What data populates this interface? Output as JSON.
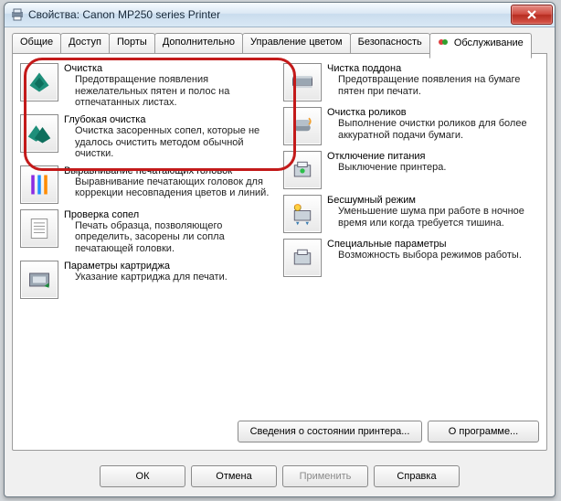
{
  "window": {
    "title": "Свойства: Canon MP250 series Printer"
  },
  "tabs": [
    {
      "label": "Общие"
    },
    {
      "label": "Доступ"
    },
    {
      "label": "Порты"
    },
    {
      "label": "Дополнительно"
    },
    {
      "label": "Управление цветом"
    },
    {
      "label": "Безопасность"
    },
    {
      "label": "Обслуживание"
    }
  ],
  "left": [
    {
      "title": "Очистка",
      "desc": "Предотвращение появления нежелательных пятен и полос на отпечатанных листах."
    },
    {
      "title": "Глубокая очистка",
      "desc": "Очистка засоренных сопел, которые не удалось очистить методом обычной очистки."
    },
    {
      "title": "Выравнивание печатающих головок",
      "desc": "Выравнивание печатающих головок для коррекции несовпадения цветов и линий."
    },
    {
      "title": "Проверка сопел",
      "desc": "Печать образца, позволяющего определить, засорены ли сопла печатающей головки."
    },
    {
      "title": "Параметры картриджа",
      "desc": "Указание картриджа для печати."
    }
  ],
  "right": [
    {
      "title": "Чистка поддона",
      "desc": "Предотвращение появления на бумаге пятен при печати."
    },
    {
      "title": "Очистка роликов",
      "desc": "Выполнение очистки роликов для более аккуратной подачи бумаги."
    },
    {
      "title": "Отключение питания",
      "desc": "Выключение принтера."
    },
    {
      "title": "Бесшумный режим",
      "desc": "Уменьшение шума при работе в ночное время или когда требуется тишина."
    },
    {
      "title": "Специальные параметры",
      "desc": "Возможность выбора режимов работы."
    }
  ],
  "panel_buttons": {
    "status": "Сведения о состоянии принтера...",
    "about": "О программе..."
  },
  "footer": {
    "ok": "ОК",
    "cancel": "Отмена",
    "apply": "Применить",
    "help": "Справка"
  }
}
